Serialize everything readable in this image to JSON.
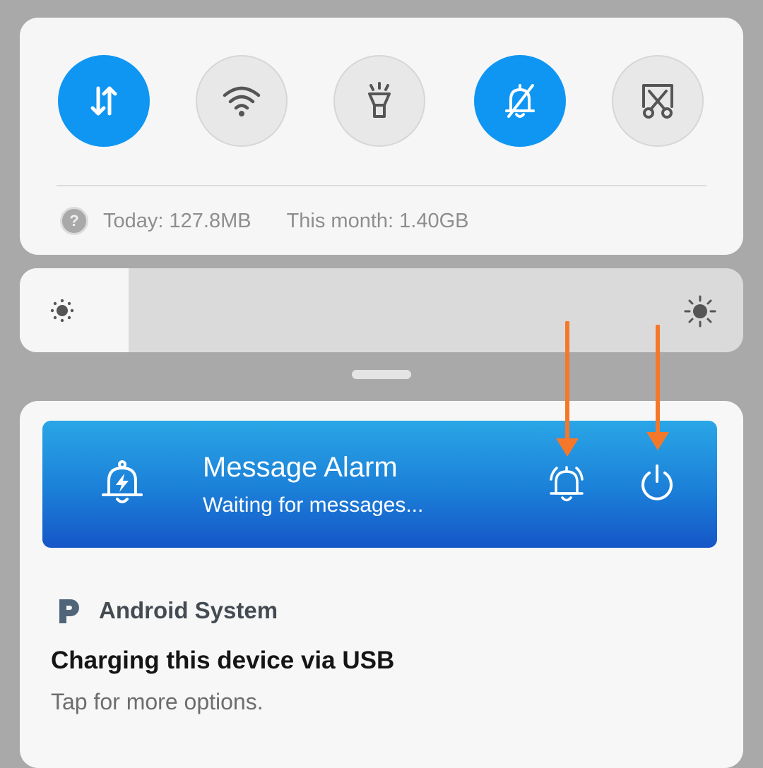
{
  "quick_settings": {
    "tiles": [
      {
        "name": "mobile-data",
        "icon": "data-arrows-icon",
        "state": "on"
      },
      {
        "name": "wifi",
        "icon": "wifi-icon",
        "state": "off"
      },
      {
        "name": "flashlight",
        "icon": "flashlight-icon",
        "state": "off"
      },
      {
        "name": "silent-mode",
        "icon": "bell-off-icon",
        "state": "on"
      },
      {
        "name": "screenshot",
        "icon": "screenshot-scissors-icon",
        "state": "off"
      }
    ],
    "data_usage": {
      "help_glyph": "?",
      "today": "Today: 127.8MB",
      "month": "This month: 1.40GB"
    }
  },
  "brightness": {
    "level": 0.15,
    "low_icon": "sun-small-icon",
    "high_icon": "sun-large-icon"
  },
  "notifications": {
    "message_alarm": {
      "title": "Message Alarm",
      "status": "Waiting for messages...",
      "app_icon": "bell-bolt-icon",
      "actions": [
        "alarm-bell-icon",
        "power-icon"
      ]
    },
    "android_system": {
      "app_icon": "android-system-p-icon",
      "app_name": "Android System",
      "title": "Charging this device via USB",
      "text": "Tap for more options."
    }
  },
  "colors": {
    "accent_blue": "#0f96f2",
    "annotation_orange": "#f5782a"
  }
}
